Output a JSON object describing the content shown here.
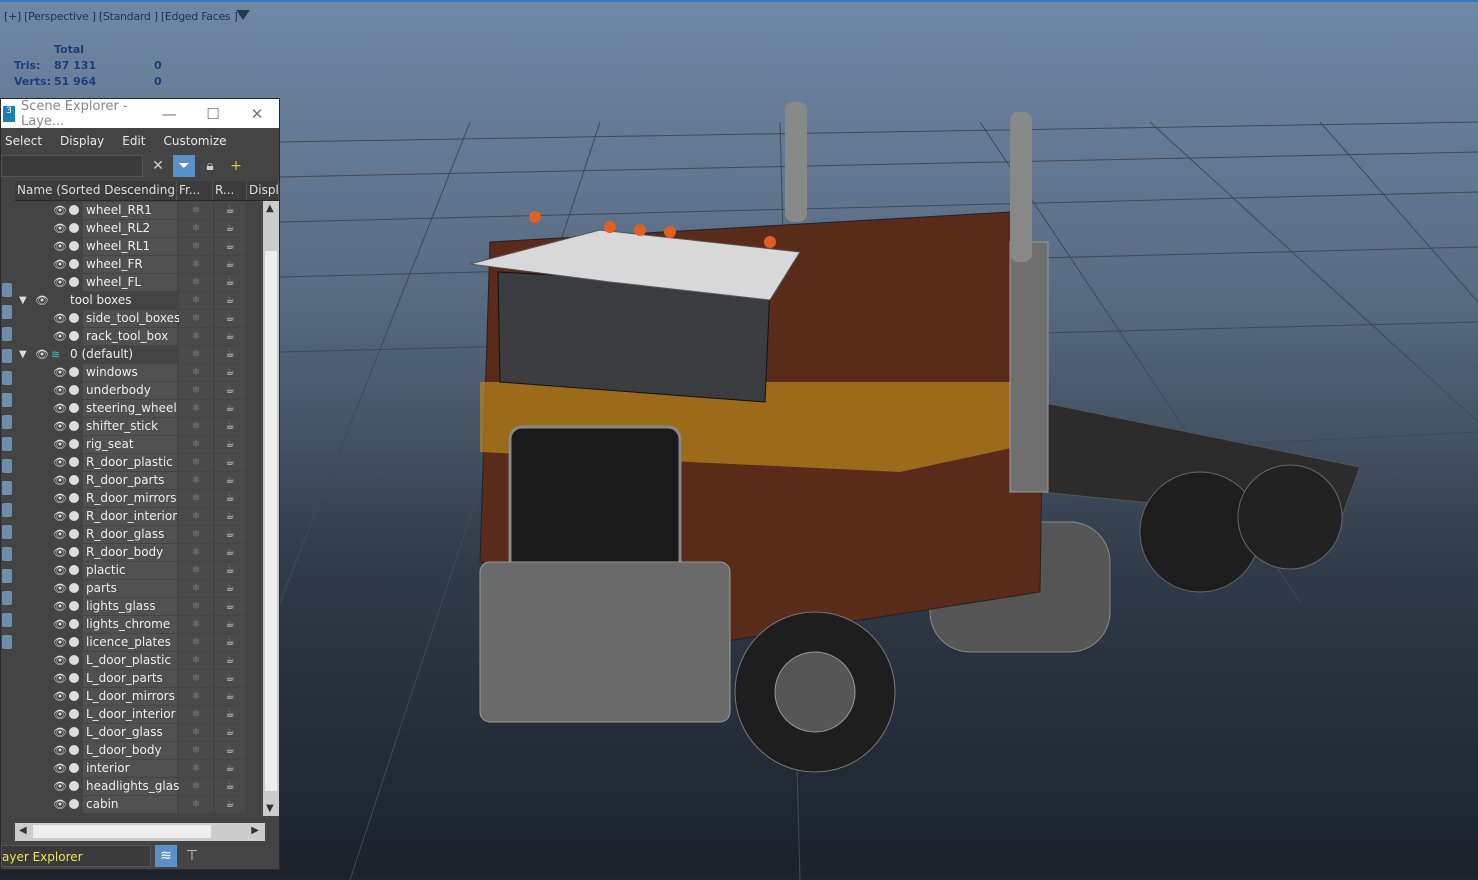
{
  "viewport": {
    "label": "[+] [Perspective ] [Standard ] [Edged Faces ]",
    "stats": {
      "total_label": "Total",
      "tris_label": "Tris:",
      "tris_value": "87 131",
      "tris_sel": "0",
      "verts_label": "Verts:",
      "verts_value": "51 964",
      "verts_sel": "0"
    }
  },
  "explorer": {
    "title": "Scene Explorer - Laye...",
    "menu": [
      "Select",
      "Display",
      "Edit",
      "Customize"
    ],
    "columns": [
      "Name (Sorted Descending)",
      "Fr...",
      "R...",
      "Displa"
    ],
    "rows": [
      {
        "name": "wheel_RR1"
      },
      {
        "name": "wheel_RL2"
      },
      {
        "name": "wheel_RL1"
      },
      {
        "name": "wheel_FR"
      },
      {
        "name": "wheel_FL"
      },
      {
        "name": "tool boxes",
        "layer": true
      },
      {
        "name": "side_tool_boxes"
      },
      {
        "name": "rack_tool_box"
      },
      {
        "name": "0 (default)",
        "layer": true,
        "active": true
      },
      {
        "name": "windows"
      },
      {
        "name": "underbody"
      },
      {
        "name": "steering_wheel"
      },
      {
        "name": "shifter_stick"
      },
      {
        "name": "rig_seat"
      },
      {
        "name": "R_door_plastic"
      },
      {
        "name": "R_door_parts"
      },
      {
        "name": "R_door_mirrors"
      },
      {
        "name": "R_door_interior"
      },
      {
        "name": "R_door_glass"
      },
      {
        "name": "R_door_body"
      },
      {
        "name": "plactic"
      },
      {
        "name": "parts"
      },
      {
        "name": "lights_glass"
      },
      {
        "name": "lights_chrome"
      },
      {
        "name": "licence_plates"
      },
      {
        "name": "L_door_plastic"
      },
      {
        "name": "L_door_parts"
      },
      {
        "name": "L_door_mirrors"
      },
      {
        "name": "L_door_interior"
      },
      {
        "name": "L_door_glass"
      },
      {
        "name": "L_door_body"
      },
      {
        "name": "interior"
      },
      {
        "name": "headlights_glass"
      },
      {
        "name": "cabin"
      }
    ],
    "mode": "ayer Explorer"
  }
}
